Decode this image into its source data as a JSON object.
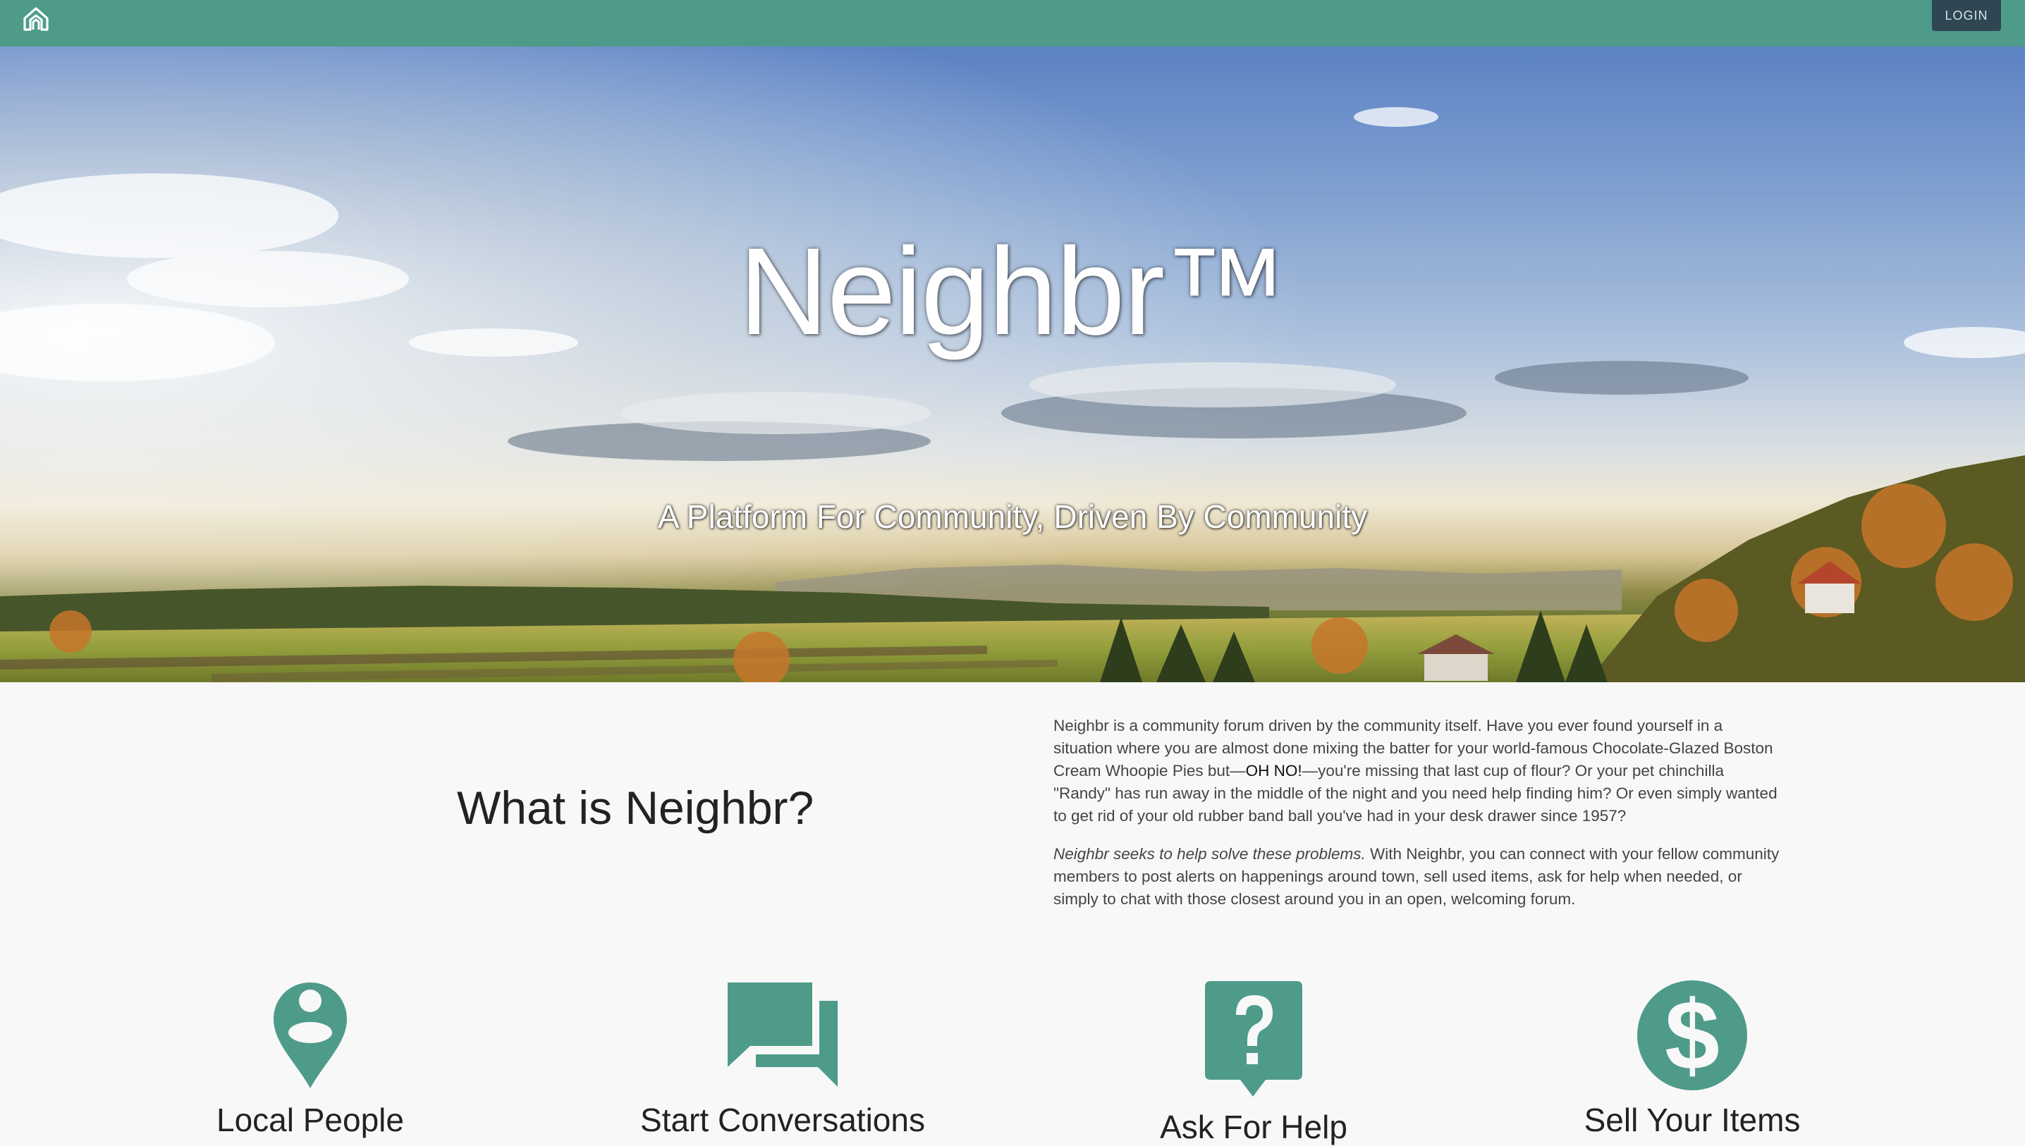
{
  "navbar": {
    "logo_icon": "home-icon",
    "login_label": "LOGIN",
    "color": "#4e9b8a"
  },
  "hero": {
    "title": "Neighbr™",
    "subtitle": "A Platform For Community, Driven By Community"
  },
  "about": {
    "heading": "What is Neighbr?",
    "paragraph1_part1": "Neighbr is a community forum driven by the community itself. Have you ever found yourself in a situation where you are almost done mixing the batter for your world-famous Chocolate-Glazed Boston Cream Whoopie Pies but—",
    "paragraph1_strong": "OH NO!",
    "paragraph1_part2": "—you're missing that last cup of flour? Or your pet chinchilla \"Randy\" has run away in the middle of the night and you need help finding him? Or even simply wanted to get rid of your old rubber band ball you've had in your desk drawer since 1957?",
    "paragraph2_em": "Neighbr seeks to help solve these problems.",
    "paragraph2_rest": " With Neighbr, you can connect with your fellow community members to post alerts on happenings around town, sell used items, ask for help when needed, or simply to chat with those closest around you in an open, welcoming forum."
  },
  "features": [
    {
      "label": "Local People",
      "icon": "location-person-icon"
    },
    {
      "label": "Start Conversations",
      "icon": "chat-bubbles-icon"
    },
    {
      "label": "Ask For Help",
      "icon": "question-bubble-icon"
    },
    {
      "label": "Sell Your Items",
      "icon": "dollar-circle-icon"
    }
  ],
  "accent_color": "#4e9b8a"
}
